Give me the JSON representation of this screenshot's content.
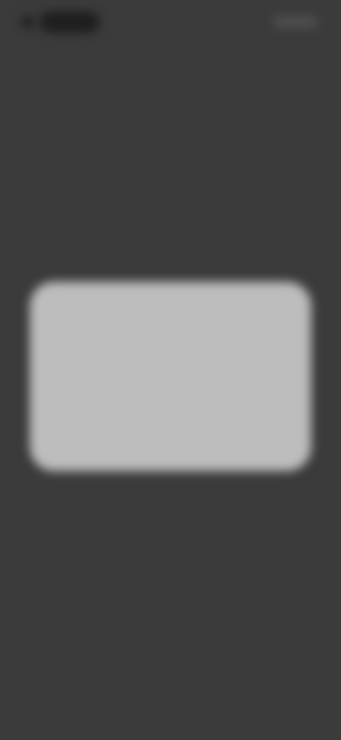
{
  "status_bar": {
    "left_icon": "back-icon",
    "right_icon": "status-right-icon"
  },
  "dialog": {
    "title": "",
    "message": "",
    "left_button_label": "",
    "right_button_label": ""
  },
  "caption": {
    "text": ""
  },
  "colors": {
    "background": "#3b3b3b",
    "dialog_background": "#bdbdbd"
  }
}
